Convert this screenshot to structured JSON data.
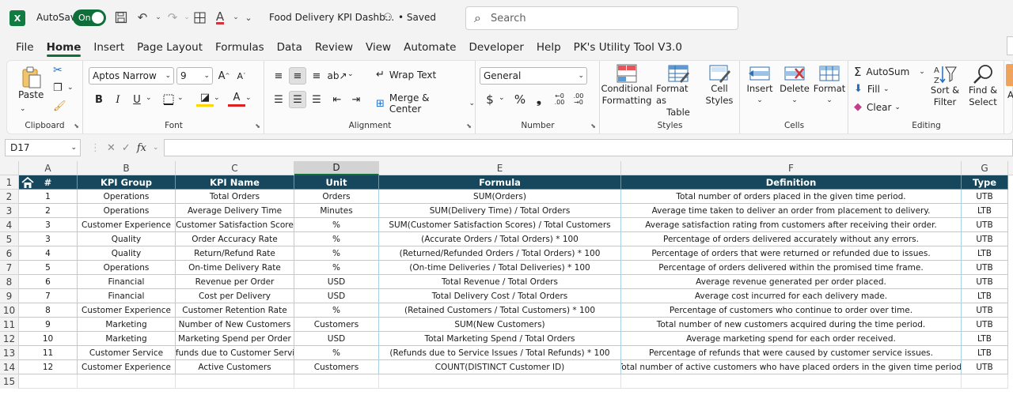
{
  "titlebar": {
    "autosave_label": "AutoSave",
    "autosave_state": "On",
    "doc_title": "Food Delivery KPI Dashb...",
    "saved": "• Saved",
    "search_placeholder": "Search"
  },
  "menu": [
    "File",
    "Home",
    "Insert",
    "Page Layout",
    "Formulas",
    "Data",
    "Review",
    "View",
    "Automate",
    "Developer",
    "Help",
    "PK's Utility Tool V3.0"
  ],
  "ribbon": {
    "clipboard": {
      "label": "Clipboard",
      "paste": "Paste"
    },
    "font": {
      "label": "Font",
      "name": "Aptos Narrow",
      "size": "9"
    },
    "alignment": {
      "label": "Alignment",
      "wrap": "Wrap Text",
      "merge": "Merge & Center"
    },
    "number": {
      "label": "Number",
      "format": "General"
    },
    "styles": {
      "label": "Styles",
      "cond1": "Conditional",
      "cond2": "Formatting",
      "fmt1": "Format as",
      "fmt2": "Table",
      "cell1": "Cell",
      "cell2": "Styles"
    },
    "cells": {
      "label": "Cells",
      "insert": "Insert",
      "delete": "Delete",
      "format": "Format"
    },
    "editing": {
      "label": "Editing",
      "autosum": "AutoSum",
      "fill": "Fill",
      "clear": "Clear",
      "sort1": "Sort &",
      "sort2": "Filter",
      "find1": "Find &",
      "find2": "Select",
      "extra": "Ad"
    }
  },
  "formula_bar": {
    "name_box": "D17",
    "fx": "fx",
    "value": ""
  },
  "columns": [
    "A",
    "B",
    "C",
    "D",
    "E",
    "F",
    "G"
  ],
  "rows": [
    "1",
    "2",
    "3",
    "4",
    "5",
    "6",
    "7",
    "8",
    "9",
    "10",
    "11",
    "12",
    "13",
    "14",
    "15"
  ],
  "table": {
    "headers": [
      "#",
      "KPI Group",
      "KPI Name",
      "Unit",
      "Formula",
      "Definition",
      "Type"
    ],
    "rows": [
      [
        "1",
        "Operations",
        "Total Orders",
        "Orders",
        "SUM(Orders)",
        "Total number of orders placed in the given time period.",
        "UTB"
      ],
      [
        "2",
        "Operations",
        "Average Delivery Time",
        "Minutes",
        "SUM(Delivery Time) / Total Orders",
        "Average time taken to deliver an order from placement to delivery.",
        "LTB"
      ],
      [
        "3",
        "Customer Experience",
        "Customer Satisfaction Score",
        "%",
        "SUM(Customer Satisfaction Scores) / Total Customers",
        "Average satisfaction rating from customers after receiving their order.",
        "UTB"
      ],
      [
        "3",
        "Quality",
        "Order Accuracy Rate",
        "%",
        "(Accurate Orders / Total Orders) * 100",
        "Percentage of orders delivered accurately without any errors.",
        "UTB"
      ],
      [
        "4",
        "Quality",
        "Return/Refund Rate",
        "%",
        "(Returned/Refunded Orders / Total Orders) * 100",
        "Percentage of orders that were returned or refunded due to issues.",
        "LTB"
      ],
      [
        "5",
        "Operations",
        "On-time Delivery Rate",
        "%",
        "(On-time Deliveries / Total Deliveries) * 100",
        "Percentage of orders delivered within the promised time frame.",
        "UTB"
      ],
      [
        "6",
        "Financial",
        "Revenue per Order",
        "USD",
        "Total Revenue / Total Orders",
        "Average revenue generated per order placed.",
        "UTB"
      ],
      [
        "7",
        "Financial",
        "Cost per Delivery",
        "USD",
        "Total Delivery Cost / Total Orders",
        "Average cost incurred for each delivery made.",
        "LTB"
      ],
      [
        "8",
        "Customer Experience",
        "Customer Retention Rate",
        "%",
        "(Retained Customers / Total Customers) * 100",
        "Percentage of customers who continue to order over time.",
        "UTB"
      ],
      [
        "9",
        "Marketing",
        "Number of New Customers",
        "Customers",
        "SUM(New Customers)",
        "Total number of new customers acquired during the time period.",
        "UTB"
      ],
      [
        "10",
        "Marketing",
        "Marketing Spend per Order",
        "USD",
        "Total Marketing Spend / Total Orders",
        "Average marketing spend for each order received.",
        "LTB"
      ],
      [
        "11",
        "Customer Service",
        "Refunds due to Customer Service",
        "%",
        "(Refunds due to Service Issues / Total Refunds) * 100",
        "Percentage of refunds that were caused by customer service issues.",
        "LTB"
      ],
      [
        "12",
        "Customer Experience",
        "Active Customers",
        "Customers",
        "COUNT(DISTINCT Customer ID)",
        "Total number of active customers who have placed orders in the given time period.",
        "UTB"
      ]
    ]
  },
  "colors": {
    "header_fill": "#17475c",
    "cell_border": "#a7d2e5",
    "accent": "#0f6e3a"
  }
}
